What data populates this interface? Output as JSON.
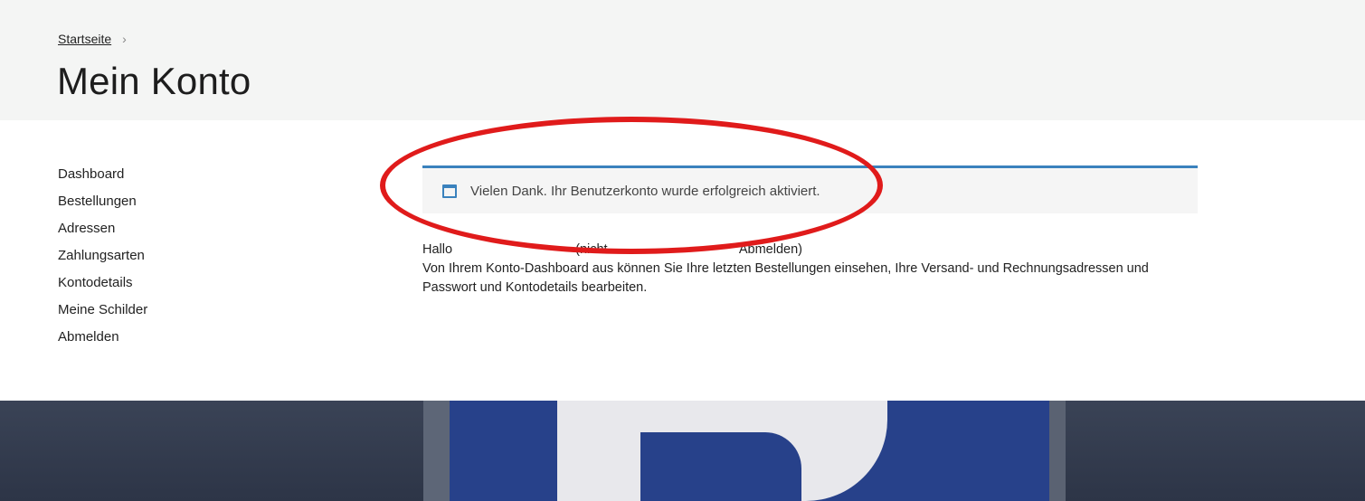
{
  "breadcrumb": {
    "home": "Startseite",
    "separator": "›"
  },
  "page": {
    "title": "Mein Konto"
  },
  "sidebar": {
    "items": [
      {
        "label": "Dashboard"
      },
      {
        "label": "Bestellungen"
      },
      {
        "label": "Adressen"
      },
      {
        "label": "Zahlungsarten"
      },
      {
        "label": "Kontodetails"
      },
      {
        "label": "Meine Schilder"
      },
      {
        "label": "Abmelden"
      }
    ]
  },
  "notice": {
    "icon": "window-icon",
    "message": "Vielen Dank. Ihr Benutzerkonto wurde erfolgreich aktiviert.",
    "accent_color": "#3a82bd"
  },
  "dashboard": {
    "greeting_start": "Hallo",
    "greeting_not": "(nicht",
    "logout_link": "Abmelden)",
    "intro": "Von Ihrem Konto-Dashboard aus können Sie Ihre letzten Bestellungen einsehen, Ihre Versand- und Rechnungsadressen und Passwort und Kontodetails bearbeiten."
  },
  "annotation": {
    "color": "#e01b1b"
  }
}
